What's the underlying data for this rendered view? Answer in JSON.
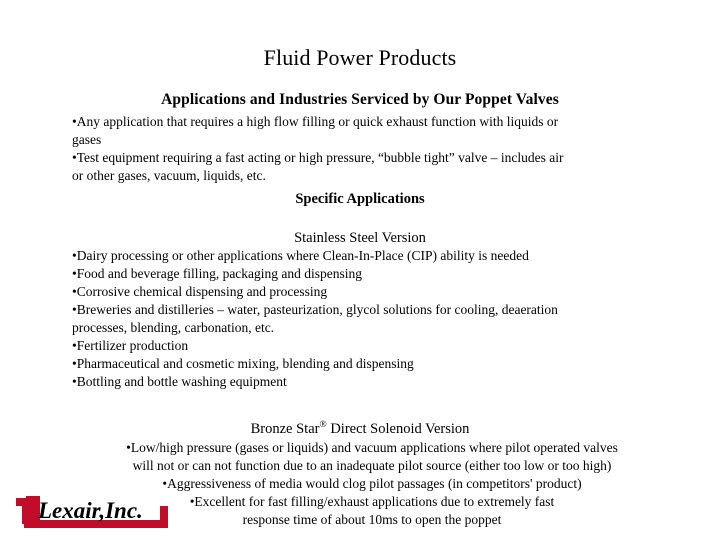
{
  "slide": {
    "title": "Fluid Power Products",
    "subtitle": "Applications and Industries Serviced by Our Poppet Valves",
    "background_color": "#ffffff",
    "text_color": "#000000"
  },
  "intro": {
    "line1": "•Any application that requires a high flow filling or quick exhaust function with liquids or",
    "line2": "gases",
    "line3": "•Test equipment requiring a fast acting or high pressure, “bubble tight” valve – includes air",
    "line4": "or other gases, vacuum, liquids, etc."
  },
  "specific_applications_heading": "Specific Applications",
  "stainless": {
    "heading": "Stainless Steel Version",
    "line1": "•Dairy processing or other applications where Clean-In-Place (CIP) ability is needed",
    "line2": "•Food and beverage filling, packaging and dispensing",
    "line3": "•Corrosive chemical dispensing and processing",
    "line4": "•Breweries and distilleries – water, pasteurization, glycol solutions for cooling, deaeration",
    "line5": "processes, blending, carbonation, etc.",
    "line6": "•Fertilizer production",
    "line7": "•Pharmaceutical and cosmetic mixing, blending and dispensing",
    "line8": "•Bottling and bottle washing equipment"
  },
  "bronze": {
    "heading_before": "Bronze Star",
    "heading_mark": "®",
    "heading_after": " Direct Solenoid Version",
    "line1": "•Low/high pressure (gases or liquids) and vacuum applications where pilot operated valves",
    "line2": "will not or can not function due to an inadequate pilot source (either too low or too high)",
    "line3": "•Aggressiveness of media would clog pilot passages (in competitors' product)",
    "line4": "•Excellent for fast filling/exhaust applications due to extremely fast",
    "line5": "response time of about 10ms to open the poppet"
  },
  "logo": {
    "text": "Lexair, Inc.",
    "red": "#C00E2A",
    "black": "#000000"
  }
}
